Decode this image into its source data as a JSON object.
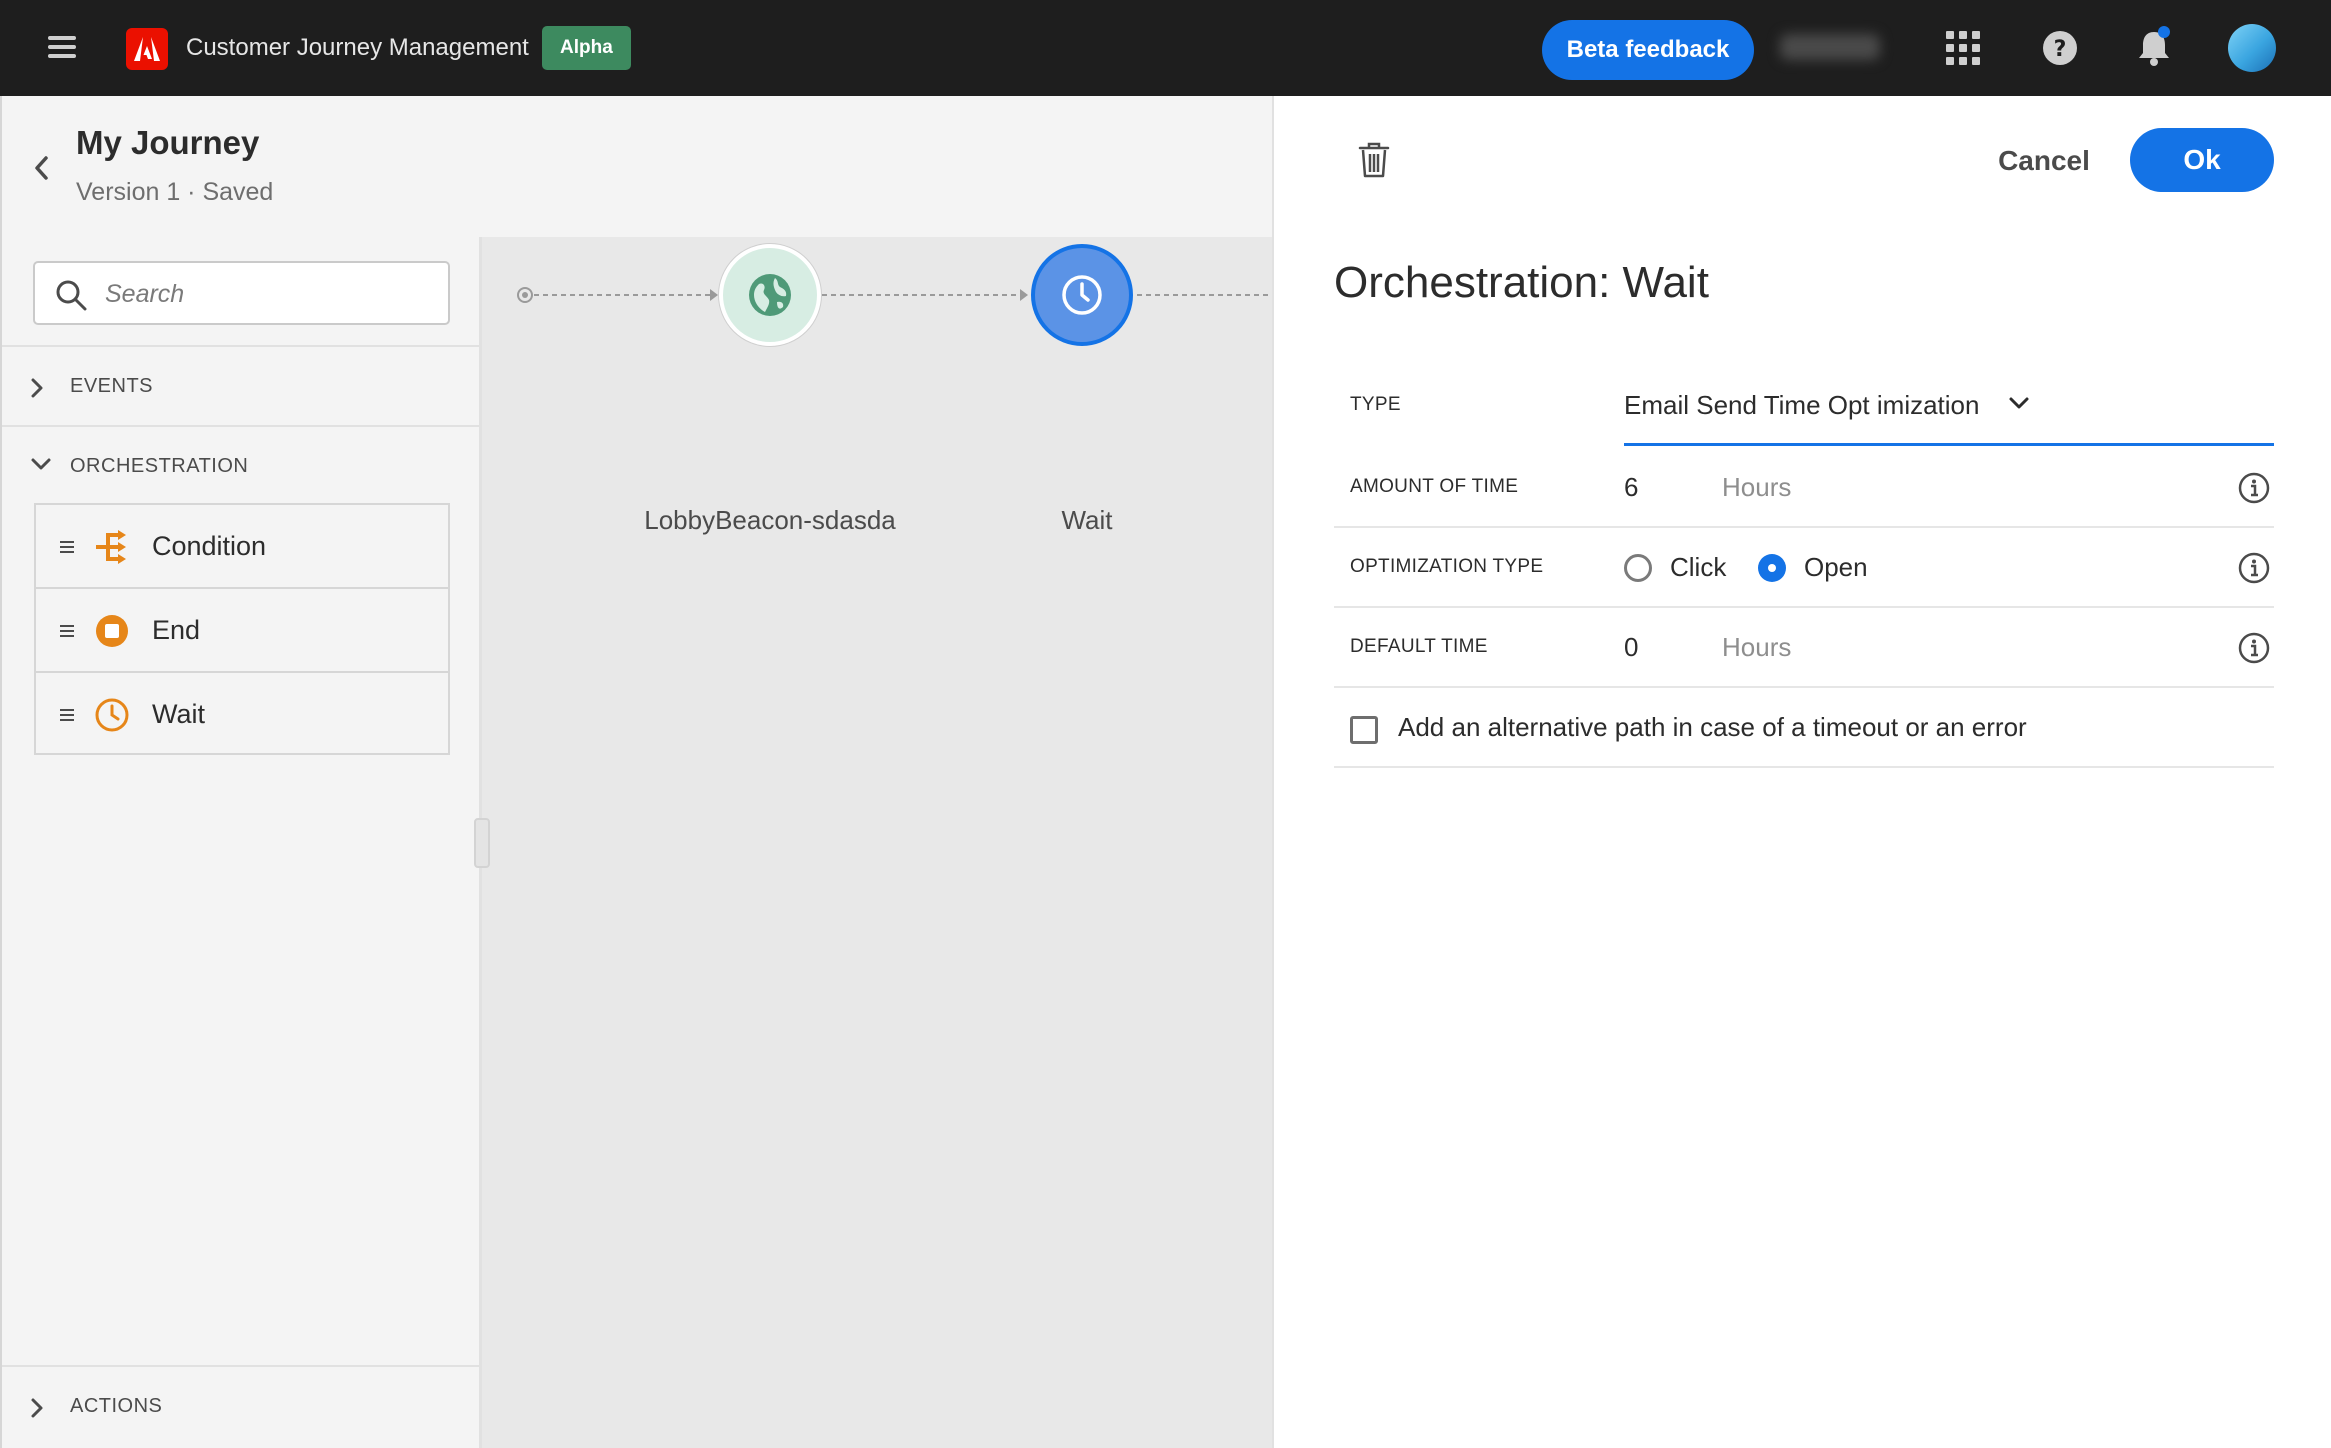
{
  "topbar": {
    "app_title": "Customer Journey Management",
    "badge": "Alpha",
    "beta_feedback": "Beta feedback",
    "icons": [
      "menu-icon",
      "adobe-logo",
      "apps-grid-icon",
      "help-icon",
      "notification-bell-icon",
      "avatar"
    ]
  },
  "journey": {
    "title": "My Journey",
    "subtitle": "Version 1 · Saved"
  },
  "sidebar": {
    "search_placeholder": "Search",
    "sections": {
      "events": "EVENTS",
      "orchestration": "ORCHESTRATION",
      "actions": "ACTIONS"
    },
    "orchestration_items": [
      {
        "label": "Condition",
        "icon": "condition-icon"
      },
      {
        "label": "End",
        "icon": "end-icon"
      },
      {
        "label": "Wait",
        "icon": "wait-icon"
      }
    ]
  },
  "canvas": {
    "nodes": [
      {
        "label": "LobbyBeacon-sdasda",
        "icon": "globe-icon"
      },
      {
        "label": "Wait",
        "icon": "clock-icon"
      }
    ]
  },
  "panel": {
    "cancel": "Cancel",
    "ok": "Ok",
    "title": "Orchestration: Wait",
    "fields": {
      "type_label": "TYPE",
      "type_value": "Email Send Time Opt imization",
      "amount_label": "AMOUNT OF TIME",
      "amount_value": "6",
      "amount_unit": "Hours",
      "opt_label": "OPTIMIZATION TYPE",
      "opt_click": "Click",
      "opt_open": "Open",
      "default_label": "DEFAULT TIME",
      "default_value": "0",
      "default_unit": "Hours",
      "alt_path": "Add an alternative path in case of a timeout or an error"
    }
  },
  "colors": {
    "accent": "#1473e6",
    "orange": "#e68619",
    "alpha_green": "#3d8a5f",
    "topbar": "#1e1e1e"
  }
}
